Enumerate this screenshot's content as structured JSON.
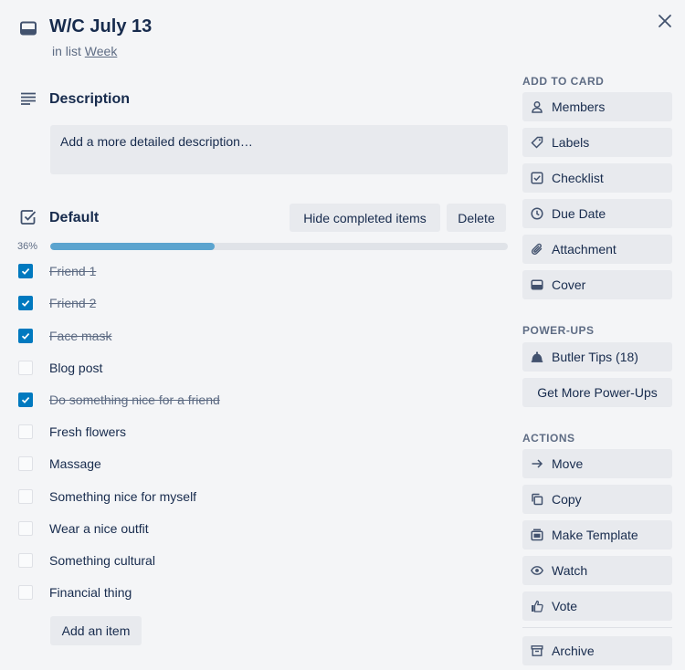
{
  "card": {
    "title": "W/C July 13",
    "list_prefix": "in list ",
    "list_name": "Week"
  },
  "description": {
    "heading": "Description",
    "placeholder": "Add a more detailed description…"
  },
  "checklist": {
    "heading": "Default",
    "hide_completed_label": "Hide completed items",
    "delete_label": "Delete",
    "progress_label": "36%",
    "progress_fraction": 0.36,
    "items": [
      {
        "text": "Friend 1",
        "checked": true
      },
      {
        "text": "Friend 2",
        "checked": true
      },
      {
        "text": "Face mask",
        "checked": true
      },
      {
        "text": "Blog post",
        "checked": false
      },
      {
        "text": "Do something nice for a friend",
        "checked": true
      },
      {
        "text": "Fresh flowers",
        "checked": false
      },
      {
        "text": "Massage",
        "checked": false
      },
      {
        "text": "Something nice for myself",
        "checked": false
      },
      {
        "text": "Wear a nice outfit",
        "checked": false
      },
      {
        "text": "Something cultural",
        "checked": false
      },
      {
        "text": "Financial thing",
        "checked": false
      }
    ],
    "add_item_label": "Add an item"
  },
  "sidebar": {
    "add_to_card_heading": "ADD TO CARD",
    "add_to_card": [
      {
        "label": "Members",
        "icon": "person-icon"
      },
      {
        "label": "Labels",
        "icon": "tag-icon"
      },
      {
        "label": "Checklist",
        "icon": "checkbox-icon"
      },
      {
        "label": "Due Date",
        "icon": "clock-icon"
      },
      {
        "label": "Attachment",
        "icon": "paperclip-icon"
      },
      {
        "label": "Cover",
        "icon": "cover-icon"
      }
    ],
    "powerups_heading": "POWER-UPS",
    "butler_label": "Butler Tips (18)",
    "get_more_label": "Get More Power-Ups",
    "actions_heading": "ACTIONS",
    "actions": [
      {
        "label": "Move",
        "icon": "arrow-right-icon"
      },
      {
        "label": "Copy",
        "icon": "copy-icon"
      },
      {
        "label": "Make Template",
        "icon": "template-icon"
      },
      {
        "label": "Watch",
        "icon": "eye-icon"
      },
      {
        "label": "Vote",
        "icon": "thumbs-up-icon"
      }
    ],
    "archive_label": "Archive"
  },
  "colors": {
    "background": "#f4f5f7",
    "button": "#e8eaee",
    "checkbox_checked": "#0079bf",
    "progress": "#5ba4cf",
    "text": "#172b4d",
    "muted": "#5e6c84"
  }
}
